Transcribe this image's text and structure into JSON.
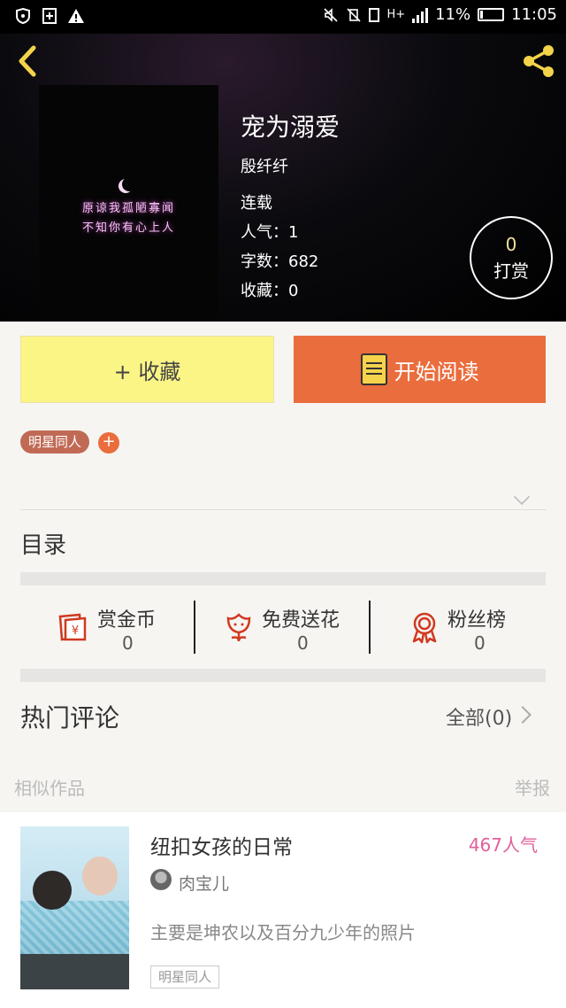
{
  "status_bar": {
    "battery": "11%",
    "time": "11:05",
    "network": "H+"
  },
  "book": {
    "title": "宠为溺爱",
    "author": "殷纤纤",
    "status": "连载",
    "popularity": "人气：1",
    "word_count": "字数：682",
    "favorites": "收藏：0",
    "cover_lines": [
      "原谅我孤陋寡闻",
      "不知你有心上人"
    ]
  },
  "reward": {
    "count": "0",
    "label": "打赏"
  },
  "actions": {
    "collect_label": "+ 收藏",
    "read_label": "开始阅读"
  },
  "tags": {
    "primary": "明星同人",
    "add": "+"
  },
  "toc_label": "目录",
  "stats": [
    {
      "label": "赏金币",
      "value": "0",
      "icon": "red-envelope-icon"
    },
    {
      "label": "免费送花",
      "value": "0",
      "icon": "flower-icon"
    },
    {
      "label": "粉丝榜",
      "value": "0",
      "icon": "ribbon-icon"
    }
  ],
  "comments": {
    "heading": "热门评论",
    "all_label": "全部(0)"
  },
  "similar": {
    "heading": "相似作品",
    "report_label": "举报",
    "items": [
      {
        "title": "纽扣女孩的日常",
        "popularity": "467人气",
        "author": "肉宝儿",
        "description": "主要是坤农以及百分九少年的照片",
        "tag": "明星同人"
      }
    ]
  },
  "colors": {
    "accent_orange": "#ea6d3d",
    "collect_yellow": "#fbf586",
    "tag_brown": "#c06a55",
    "popularity_pink": "#e0609a",
    "reward_gold": "#f3e29b"
  }
}
